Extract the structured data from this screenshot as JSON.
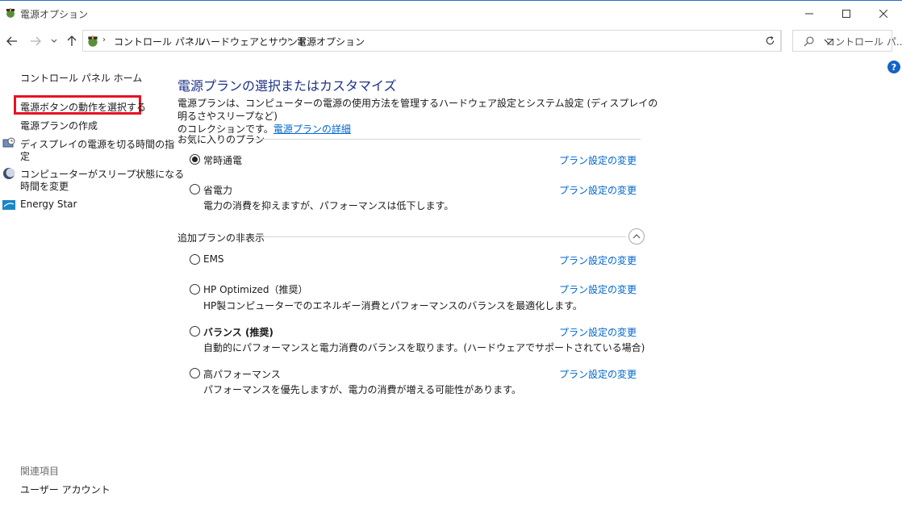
{
  "window": {
    "title": "電源オプション"
  },
  "address": {
    "breadcrumbs": [
      "コントロール パネル",
      "ハードウェアとサウンド",
      "電源オプション"
    ],
    "search_placeholder": "コントロール パ..."
  },
  "sidebar": {
    "home": "コントロール パネル ホーム",
    "items": [
      {
        "label": "電源ボタンの動作を選択する",
        "icon": "none",
        "highlighted": true
      },
      {
        "label": "電源プランの作成",
        "icon": "none"
      },
      {
        "label_line1": "ディスプレイの電源を切る時間の指",
        "label_line2": "定",
        "icon": "display-clock-icon"
      },
      {
        "label_line1": "コンピューターがスリープ状態になる",
        "label_line2": "時間を変更",
        "icon": "sleep-moon-icon"
      },
      {
        "label": "Energy Star",
        "icon": "energy-star-icon"
      }
    ],
    "related_label": "関連項目",
    "related_items": [
      "ユーザー アカウント"
    ]
  },
  "main": {
    "title": "電源プランの選択またはカスタマイズ",
    "description_line1": "電源プランは、コンピューターの電源の使用方法を管理するハードウェア設定とシステム設定 (ディスプレイの明るさやスリープなど)",
    "description_line2": "のコレクションです。",
    "description_link": "電源プランの詳細",
    "favorites_header": "お気に入りのプラン",
    "hidden_header": "追加プランの非表示",
    "change_link": "プラン設定の変更",
    "favorite_plans": [
      {
        "name": "常時通電",
        "description": "",
        "selected": true
      },
      {
        "name": "省電力",
        "description": "電力の消費を抑えますが、パフォーマンスは低下します。",
        "selected": false
      }
    ],
    "hidden_plans": [
      {
        "name": "EMS",
        "description": "",
        "selected": false
      },
      {
        "name": "HP Optimized（推奨）",
        "description": "HP製コンピューターでのエネルギー消費とパフォーマンスのバランスを最適化します。",
        "selected": false
      },
      {
        "name": "バランス (推奨)",
        "description": "自動的にパフォーマンスと電力消費のバランスを取ります。(ハードウェアでサポートされている場合)",
        "selected": false,
        "bold": true
      },
      {
        "name": "高パフォーマンス",
        "description": "パフォーマンスを優先しますが、電力の消費が増える可能性があります。",
        "selected": false
      }
    ]
  },
  "colors": {
    "title_blue": "#1e3287",
    "link_blue": "#0066cc",
    "highlight_red": "#e81123"
  }
}
